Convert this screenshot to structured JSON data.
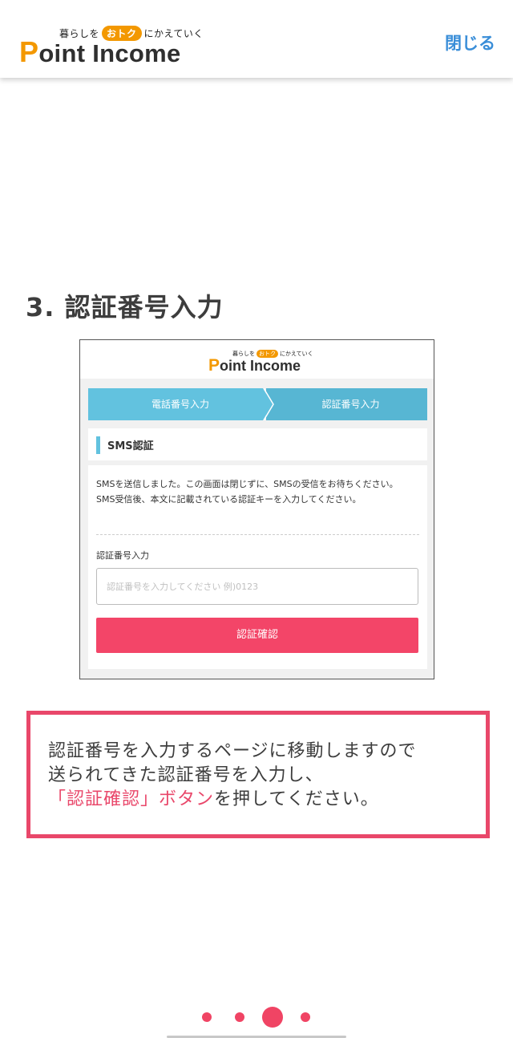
{
  "header": {
    "logo_tagline_pre": "暮らしを",
    "logo_tagline_badge": "おトク",
    "logo_tagline_post": "にかえていく",
    "logo_brand_initial": "P",
    "logo_brand_rest": "oint Income",
    "close_label": "閉じる"
  },
  "step": {
    "title": "3. 認証番号入力"
  },
  "mock": {
    "logo_tagline_pre": "暮らしを",
    "logo_tagline_badge": "おトク",
    "logo_tagline_post": "にかえていく",
    "logo_brand_initial": "P",
    "logo_brand_rest": "oint Income",
    "steps": [
      "電話番号入力",
      "認証番号入力"
    ],
    "section_title": "SMS認証",
    "message_line1": "SMSを送信しました。この画面は閉じずに、SMSの受信をお待ちください。",
    "message_line2": "SMS受信後、本文に記載されている認証キーを入力してください。",
    "input_label": "認証番号入力",
    "input_placeholder": "認証番号を入力してください 例)0123",
    "submit_label": "認証確認"
  },
  "info": {
    "line1": "認証番号を入力するページに移動しますので",
    "line2": "送られてきた認証番号を入力し、",
    "line3_highlight": "「認証確認」ボタン",
    "line3_rest": "を押してください。"
  },
  "pager": {
    "total": 4,
    "active_index": 2,
    "color": "#f04464"
  },
  "colors": {
    "accent_pink": "#e9476a",
    "close_blue": "#3a8ed8",
    "brand_orange": "#f39800",
    "step_blue": "#62c2df"
  }
}
